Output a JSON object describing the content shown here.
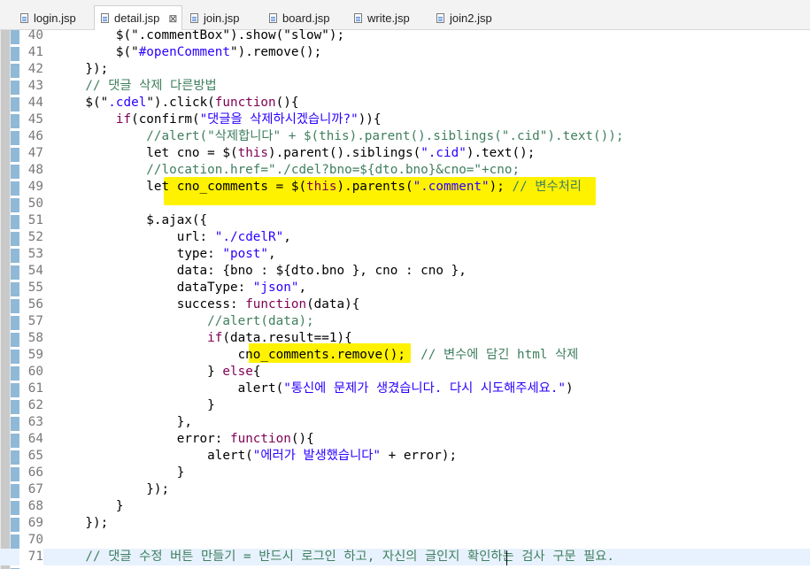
{
  "tabs": [
    {
      "label": "login.jsp",
      "active": false,
      "closable": false
    },
    {
      "label": "detail.jsp",
      "active": true,
      "closable": true
    },
    {
      "label": "join.jsp",
      "active": false,
      "closable": false
    },
    {
      "label": "board.jsp",
      "active": false,
      "closable": false
    },
    {
      "label": "write.jsp",
      "active": false,
      "closable": false
    },
    {
      "label": "join2.jsp",
      "active": false,
      "closable": false
    }
  ],
  "close_glyph": "⊠",
  "lines": [
    {
      "num": "40",
      "parts": [
        [
          "p",
          "        $(\".commentBox\").show(\"slow\");"
        ]
      ]
    },
    {
      "num": "41",
      "parts": [
        [
          "p",
          "        $(\""
        ],
        [
          "s",
          "#openComment"
        ],
        [
          "p",
          "\").remove();"
        ]
      ]
    },
    {
      "num": "42",
      "parts": [
        [
          "p",
          "    });"
        ]
      ]
    },
    {
      "num": "43",
      "parts": [
        [
          "c",
          "    // 댓글 삭제 다른방법"
        ]
      ]
    },
    {
      "num": "44",
      "parts": [
        [
          "p",
          "    $(\""
        ],
        [
          "s",
          ".cdel"
        ],
        [
          "p",
          "\").click("
        ],
        [
          "k",
          "function"
        ],
        [
          "p",
          "(){"
        ]
      ]
    },
    {
      "num": "45",
      "parts": [
        [
          "p",
          "        "
        ],
        [
          "k",
          "if"
        ],
        [
          "p",
          "(confirm("
        ],
        [
          "s",
          "\"댓글을 삭제하시겠습니까?\""
        ],
        [
          "p",
          ")){"
        ]
      ]
    },
    {
      "num": "46",
      "parts": [
        [
          "c",
          "            //alert(\"삭제합니다\" + $(this).parent().siblings(\".cid\").text());"
        ]
      ]
    },
    {
      "num": "47",
      "parts": [
        [
          "p",
          "            let cno = $("
        ],
        [
          "k",
          "this"
        ],
        [
          "p",
          ").parent().siblings("
        ],
        [
          "s",
          "\".cid\""
        ],
        [
          "p",
          ").text();"
        ]
      ]
    },
    {
      "num": "48",
      "parts": [
        [
          "c",
          "            //location.href=\"./cdel?bno=${dto.bno}&cno=\"+cno;"
        ]
      ]
    },
    {
      "num": "49",
      "parts": [
        [
          "p",
          "            let cno_comments = $("
        ],
        [
          "k",
          "this"
        ],
        [
          "p",
          ").parents("
        ],
        [
          "s",
          "\".comment\""
        ],
        [
          "p",
          "); "
        ],
        [
          "c",
          "// 변수처리"
        ]
      ]
    },
    {
      "num": "50",
      "parts": [
        [
          "p",
          ""
        ]
      ]
    },
    {
      "num": "51",
      "parts": [
        [
          "p",
          "            $.ajax({"
        ]
      ]
    },
    {
      "num": "52",
      "parts": [
        [
          "p",
          "                url: "
        ],
        [
          "s",
          "\"./cdelR\""
        ],
        [
          "p",
          ","
        ]
      ]
    },
    {
      "num": "53",
      "parts": [
        [
          "p",
          "                type: "
        ],
        [
          "s",
          "\"post\""
        ],
        [
          "p",
          ","
        ]
      ]
    },
    {
      "num": "54",
      "parts": [
        [
          "p",
          "                data: {bno : ${dto.bno }, cno : cno },"
        ]
      ]
    },
    {
      "num": "55",
      "parts": [
        [
          "p",
          "                dataType: "
        ],
        [
          "s",
          "\"json\""
        ],
        [
          "p",
          ","
        ]
      ]
    },
    {
      "num": "56",
      "parts": [
        [
          "p",
          "                success: "
        ],
        [
          "k",
          "function"
        ],
        [
          "p",
          "(data){"
        ]
      ]
    },
    {
      "num": "57",
      "parts": [
        [
          "c",
          "                    //alert(data);"
        ]
      ]
    },
    {
      "num": "58",
      "parts": [
        [
          "p",
          "                    "
        ],
        [
          "k",
          "if"
        ],
        [
          "p",
          "(data.result==1){"
        ]
      ]
    },
    {
      "num": "59",
      "parts": [
        [
          "p",
          "                        cno_comments.remove();  "
        ],
        [
          "c",
          "// 변수에 담긴 html 삭제"
        ]
      ]
    },
    {
      "num": "60",
      "parts": [
        [
          "p",
          "                    } "
        ],
        [
          "k",
          "else"
        ],
        [
          "p",
          "{"
        ]
      ]
    },
    {
      "num": "61",
      "parts": [
        [
          "p",
          "                        alert("
        ],
        [
          "s",
          "\"통신에 문제가 생겼습니다. 다시 시도해주세요.\""
        ],
        [
          "p",
          ")"
        ]
      ]
    },
    {
      "num": "62",
      "parts": [
        [
          "p",
          "                    }"
        ]
      ]
    },
    {
      "num": "63",
      "parts": [
        [
          "p",
          "                },"
        ]
      ]
    },
    {
      "num": "64",
      "parts": [
        [
          "p",
          "                error: "
        ],
        [
          "k",
          "function"
        ],
        [
          "p",
          "(){"
        ]
      ]
    },
    {
      "num": "65",
      "parts": [
        [
          "p",
          "                    alert("
        ],
        [
          "s",
          "\"에러가 발생했습니다\""
        ],
        [
          "p",
          " + error);"
        ]
      ]
    },
    {
      "num": "66",
      "parts": [
        [
          "p",
          "                }"
        ]
      ]
    },
    {
      "num": "67",
      "parts": [
        [
          "p",
          "            });"
        ]
      ]
    },
    {
      "num": "68",
      "parts": [
        [
          "p",
          "        }"
        ]
      ]
    },
    {
      "num": "69",
      "parts": [
        [
          "p",
          "    });"
        ]
      ]
    },
    {
      "num": "70",
      "parts": [
        [
          "p",
          ""
        ]
      ]
    },
    {
      "num": "71",
      "parts": [
        [
          "c",
          "    // 댓글 수정 버튼 만들기 = 반드시 로그인 하고, 자신의 글인지 확인하는 검사 구문 필요."
        ]
      ],
      "current": true
    }
  ],
  "colors": {
    "keyword": "#7f0055",
    "string": "#2a00ff",
    "comment": "#3f7f5f",
    "highlight": "#fff200",
    "current_line": "#e8f2fe"
  }
}
